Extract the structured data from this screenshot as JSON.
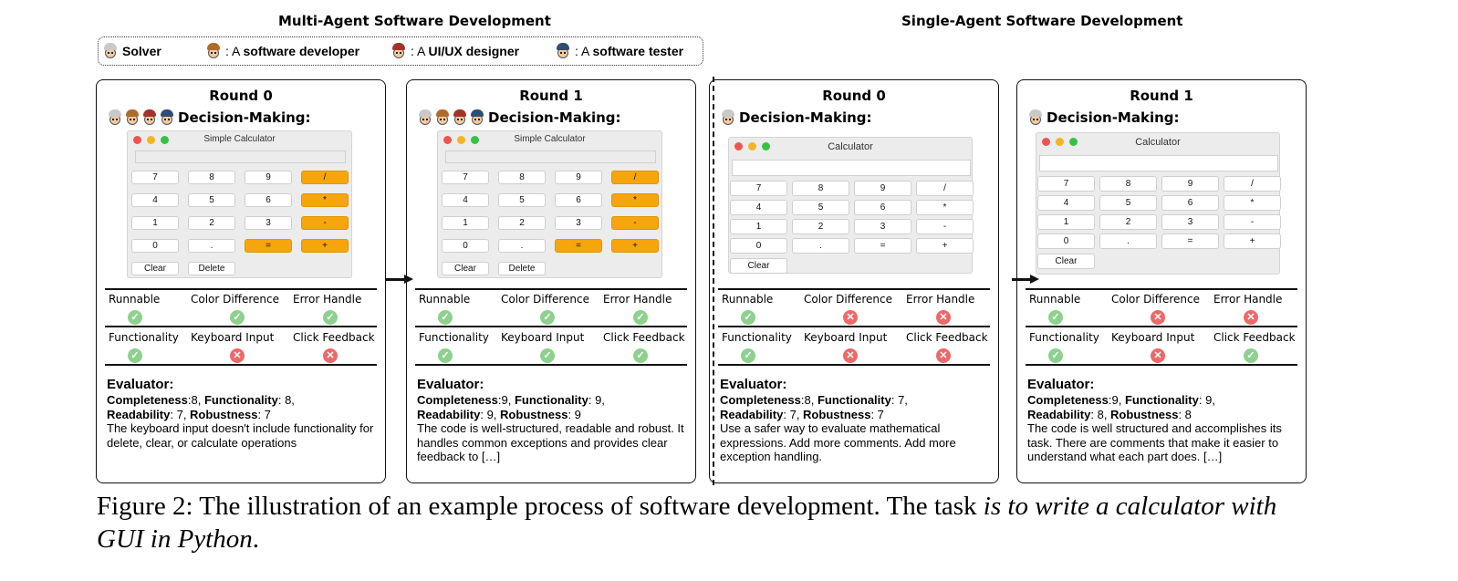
{
  "headers": {
    "multi": "Multi-Agent Software Development",
    "single": "Single-Agent Software Development"
  },
  "legend": [
    {
      "name": "Solver",
      "prefix": "",
      "bold": "Solver",
      "hair": "#c9c9c9"
    },
    {
      "name": "software-developer",
      "prefix": "A ",
      "bold": "software developer",
      "hair": "#b06a2a"
    },
    {
      "name": "ui-ux-designer",
      "prefix": "A ",
      "bold": "UI/UX designer",
      "hair": "#a3332a"
    },
    {
      "name": "software-tester",
      "prefix": "A ",
      "bold": "software tester",
      "hair": "#2f4e73"
    }
  ],
  "colors": {
    "accent_orange": "#f6a60c",
    "ok": "#8ed18e",
    "bad": "#ef6868"
  },
  "decision_label": "Decision-Making:",
  "metric_labels": [
    "Runnable",
    "Color Difference",
    "Error Handle",
    "Functionality",
    "Keyboard Input",
    "Click Feedback"
  ],
  "panels": [
    {
      "round": "Round 0",
      "multi": true,
      "calc_style": "orange",
      "calc_title": "Simple Calculator",
      "keys": [
        "7",
        "8",
        "9",
        "/",
        "4",
        "5",
        "6",
        "*",
        "1",
        "2",
        "3",
        "-",
        "0",
        ".",
        "=",
        "+",
        "Clear",
        "Delete"
      ],
      "metrics": [
        true,
        true,
        true,
        true,
        false,
        false
      ],
      "evaluator_title": "Evaluator:",
      "scores": [
        "Completeness",
        ":8, ",
        "Functionality",
        ": 8,",
        "Readability",
        ": 7, ",
        "Robustness",
        ": 7"
      ],
      "comment": "The keyboard input doesn't include functionality for delete, clear, or calculate operations"
    },
    {
      "round": "Round 1",
      "multi": true,
      "calc_style": "orange",
      "calc_title": "Simple Calculator",
      "keys": [
        "7",
        "8",
        "9",
        "/",
        "4",
        "5",
        "6",
        "*",
        "1",
        "2",
        "3",
        "-",
        "0",
        ".",
        "=",
        "+",
        "Clear",
        "Delete"
      ],
      "metrics": [
        true,
        true,
        true,
        true,
        true,
        true
      ],
      "evaluator_title": "Evaluator:",
      "scores": [
        "Completeness",
        ":9, ",
        "Functionality",
        ": 9,",
        "Readability",
        ": 9, ",
        "Robustness",
        ": 9"
      ],
      "comment": "The code is well-structured, readable and robust. It handles common exceptions and provides clear feedback to […]"
    },
    {
      "round": "Round 0",
      "multi": false,
      "calc_style": "plain",
      "calc_title": "Calculator",
      "keys": [
        "7",
        "8",
        "9",
        "/",
        "4",
        "5",
        "6",
        "*",
        "1",
        "2",
        "3",
        "-",
        "0",
        ".",
        "=",
        "+",
        "Clear"
      ],
      "metrics": [
        true,
        false,
        false,
        true,
        false,
        false
      ],
      "evaluator_title": "Evaluator:",
      "scores": [
        "Completeness",
        ":8, ",
        "Functionality",
        ": 7,",
        "Readability",
        ": 7, ",
        "Robustness",
        ": 7"
      ],
      "comment": "Use a safer way to evaluate mathematical expressions. Add more comments. Add more exception handling."
    },
    {
      "round": "Round 1",
      "multi": false,
      "calc_style": "plain",
      "calc_title": "Calculator",
      "keys": [
        "7",
        "8",
        "9",
        "/",
        "4",
        "5",
        "6",
        "*",
        "1",
        "2",
        "3",
        "-",
        "0",
        ".",
        "=",
        "+",
        "Clear"
      ],
      "metrics": [
        true,
        false,
        false,
        true,
        false,
        true
      ],
      "evaluator_title": "Evaluator:",
      "scores": [
        "Completeness",
        ":9, ",
        "Functionality",
        ": 9,",
        "Readability",
        ": 8, ",
        "Robustness",
        ": 8"
      ],
      "comment": "The code is well structured and accomplishes its task. There are comments that make it easier to understand what each part does. […]"
    }
  ],
  "caption": {
    "lead": "Figure 2: The illustration of an example process of software development. The task ",
    "italic": "is to write a calculator with GUI in Python",
    "tail": "."
  }
}
